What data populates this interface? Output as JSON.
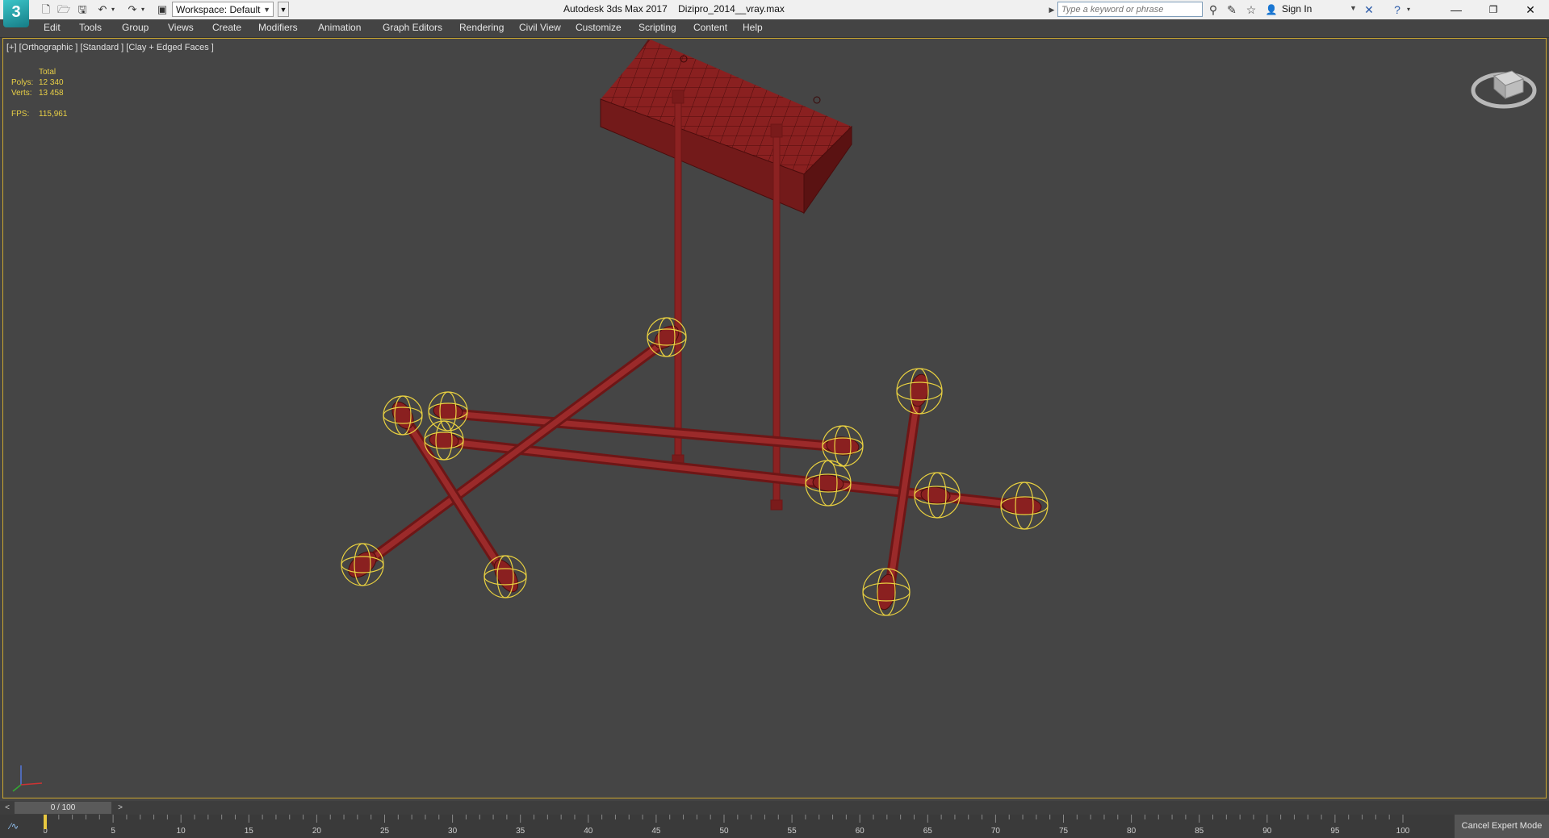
{
  "app": {
    "logo_text": "3",
    "window_title": "Autodesk 3ds Max 2017    Dizipro_2014__vray.max"
  },
  "quick_access": {
    "workspace_label": "Workspace: Default",
    "icons": [
      "new-file-icon",
      "open-file-icon",
      "save-icon",
      "undo-icon",
      "redo-icon",
      "project-folder-icon"
    ]
  },
  "search": {
    "placeholder": "Type a keyword or phrase"
  },
  "account": {
    "sign_in_label": "Sign In"
  },
  "menu": {
    "items": [
      "Edit",
      "Tools",
      "Group",
      "Views",
      "Create",
      "Modifiers",
      "Animation",
      "Graph Editors",
      "Rendering",
      "Civil View",
      "Customize",
      "Scripting",
      "Content",
      "Help"
    ]
  },
  "viewport": {
    "label": "[+] [Orthographic ] [Standard ] [Clay + Edged Faces ]",
    "stats": {
      "total_label": "Total",
      "polys_label": "Polys:",
      "polys_value": "12 340",
      "verts_label": "Verts:",
      "verts_value": "13 458",
      "fps_label": "FPS:",
      "fps_value": "115,961"
    },
    "model_color": "#7a1818",
    "selection_color": "#e8d040"
  },
  "timeline": {
    "frame_display": "0 / 100",
    "ticks": [
      "0",
      "5",
      "10",
      "15",
      "20",
      "25",
      "30",
      "35",
      "40",
      "45",
      "50",
      "55",
      "60",
      "65",
      "70",
      "75",
      "80",
      "85",
      "90",
      "95",
      "100"
    ],
    "cancel_expert_label": "Cancel Expert Mode"
  }
}
